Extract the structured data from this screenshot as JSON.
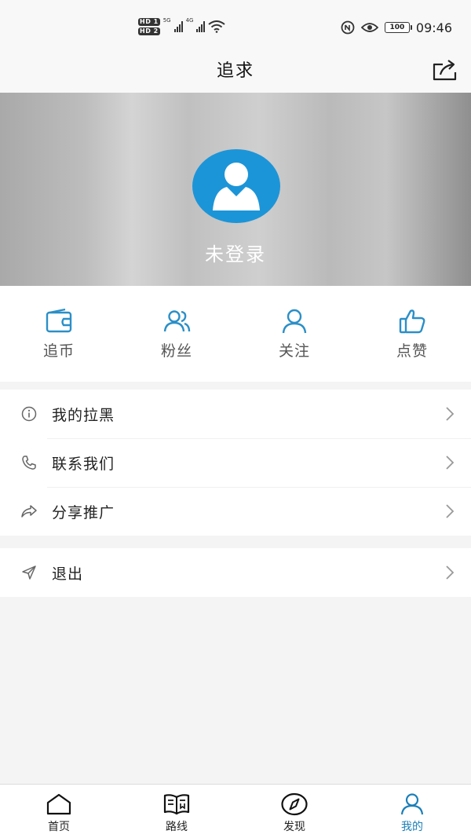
{
  "status_bar": {
    "sim1": "HD 1",
    "sim2": "HD 2",
    "network1": "5G",
    "network2": "4G",
    "battery": "100",
    "time": "09:46"
  },
  "header": {
    "title": "追求",
    "share_icon": "share-icon"
  },
  "profile": {
    "name": "未登录",
    "avatar_icon": "user-avatar-icon",
    "avatar_color": "#1c95d8"
  },
  "stats": [
    {
      "label": "追币",
      "icon": "wallet-icon"
    },
    {
      "label": "粉丝",
      "icon": "users-icon"
    },
    {
      "label": "关注",
      "icon": "user-icon"
    },
    {
      "label": "点赞",
      "icon": "thumbs-up-icon"
    }
  ],
  "menu": {
    "group1": [
      {
        "label": "我的拉黑",
        "icon": "info-icon"
      },
      {
        "label": "联系我们",
        "icon": "phone-icon"
      },
      {
        "label": "分享推广",
        "icon": "share-arrow-icon"
      }
    ],
    "group2": [
      {
        "label": "退出",
        "icon": "send-icon"
      }
    ]
  },
  "tabs": [
    {
      "label": "首页",
      "icon": "home-icon",
      "active": false
    },
    {
      "label": "路线",
      "icon": "book-icon",
      "active": false
    },
    {
      "label": "发现",
      "icon": "compass-icon",
      "active": false
    },
    {
      "label": "我的",
      "icon": "user-icon",
      "active": true
    }
  ],
  "colors": {
    "accent": "#1c7fb8",
    "icon_blue": "#2b8fc7",
    "background": "#f4f4f4"
  }
}
